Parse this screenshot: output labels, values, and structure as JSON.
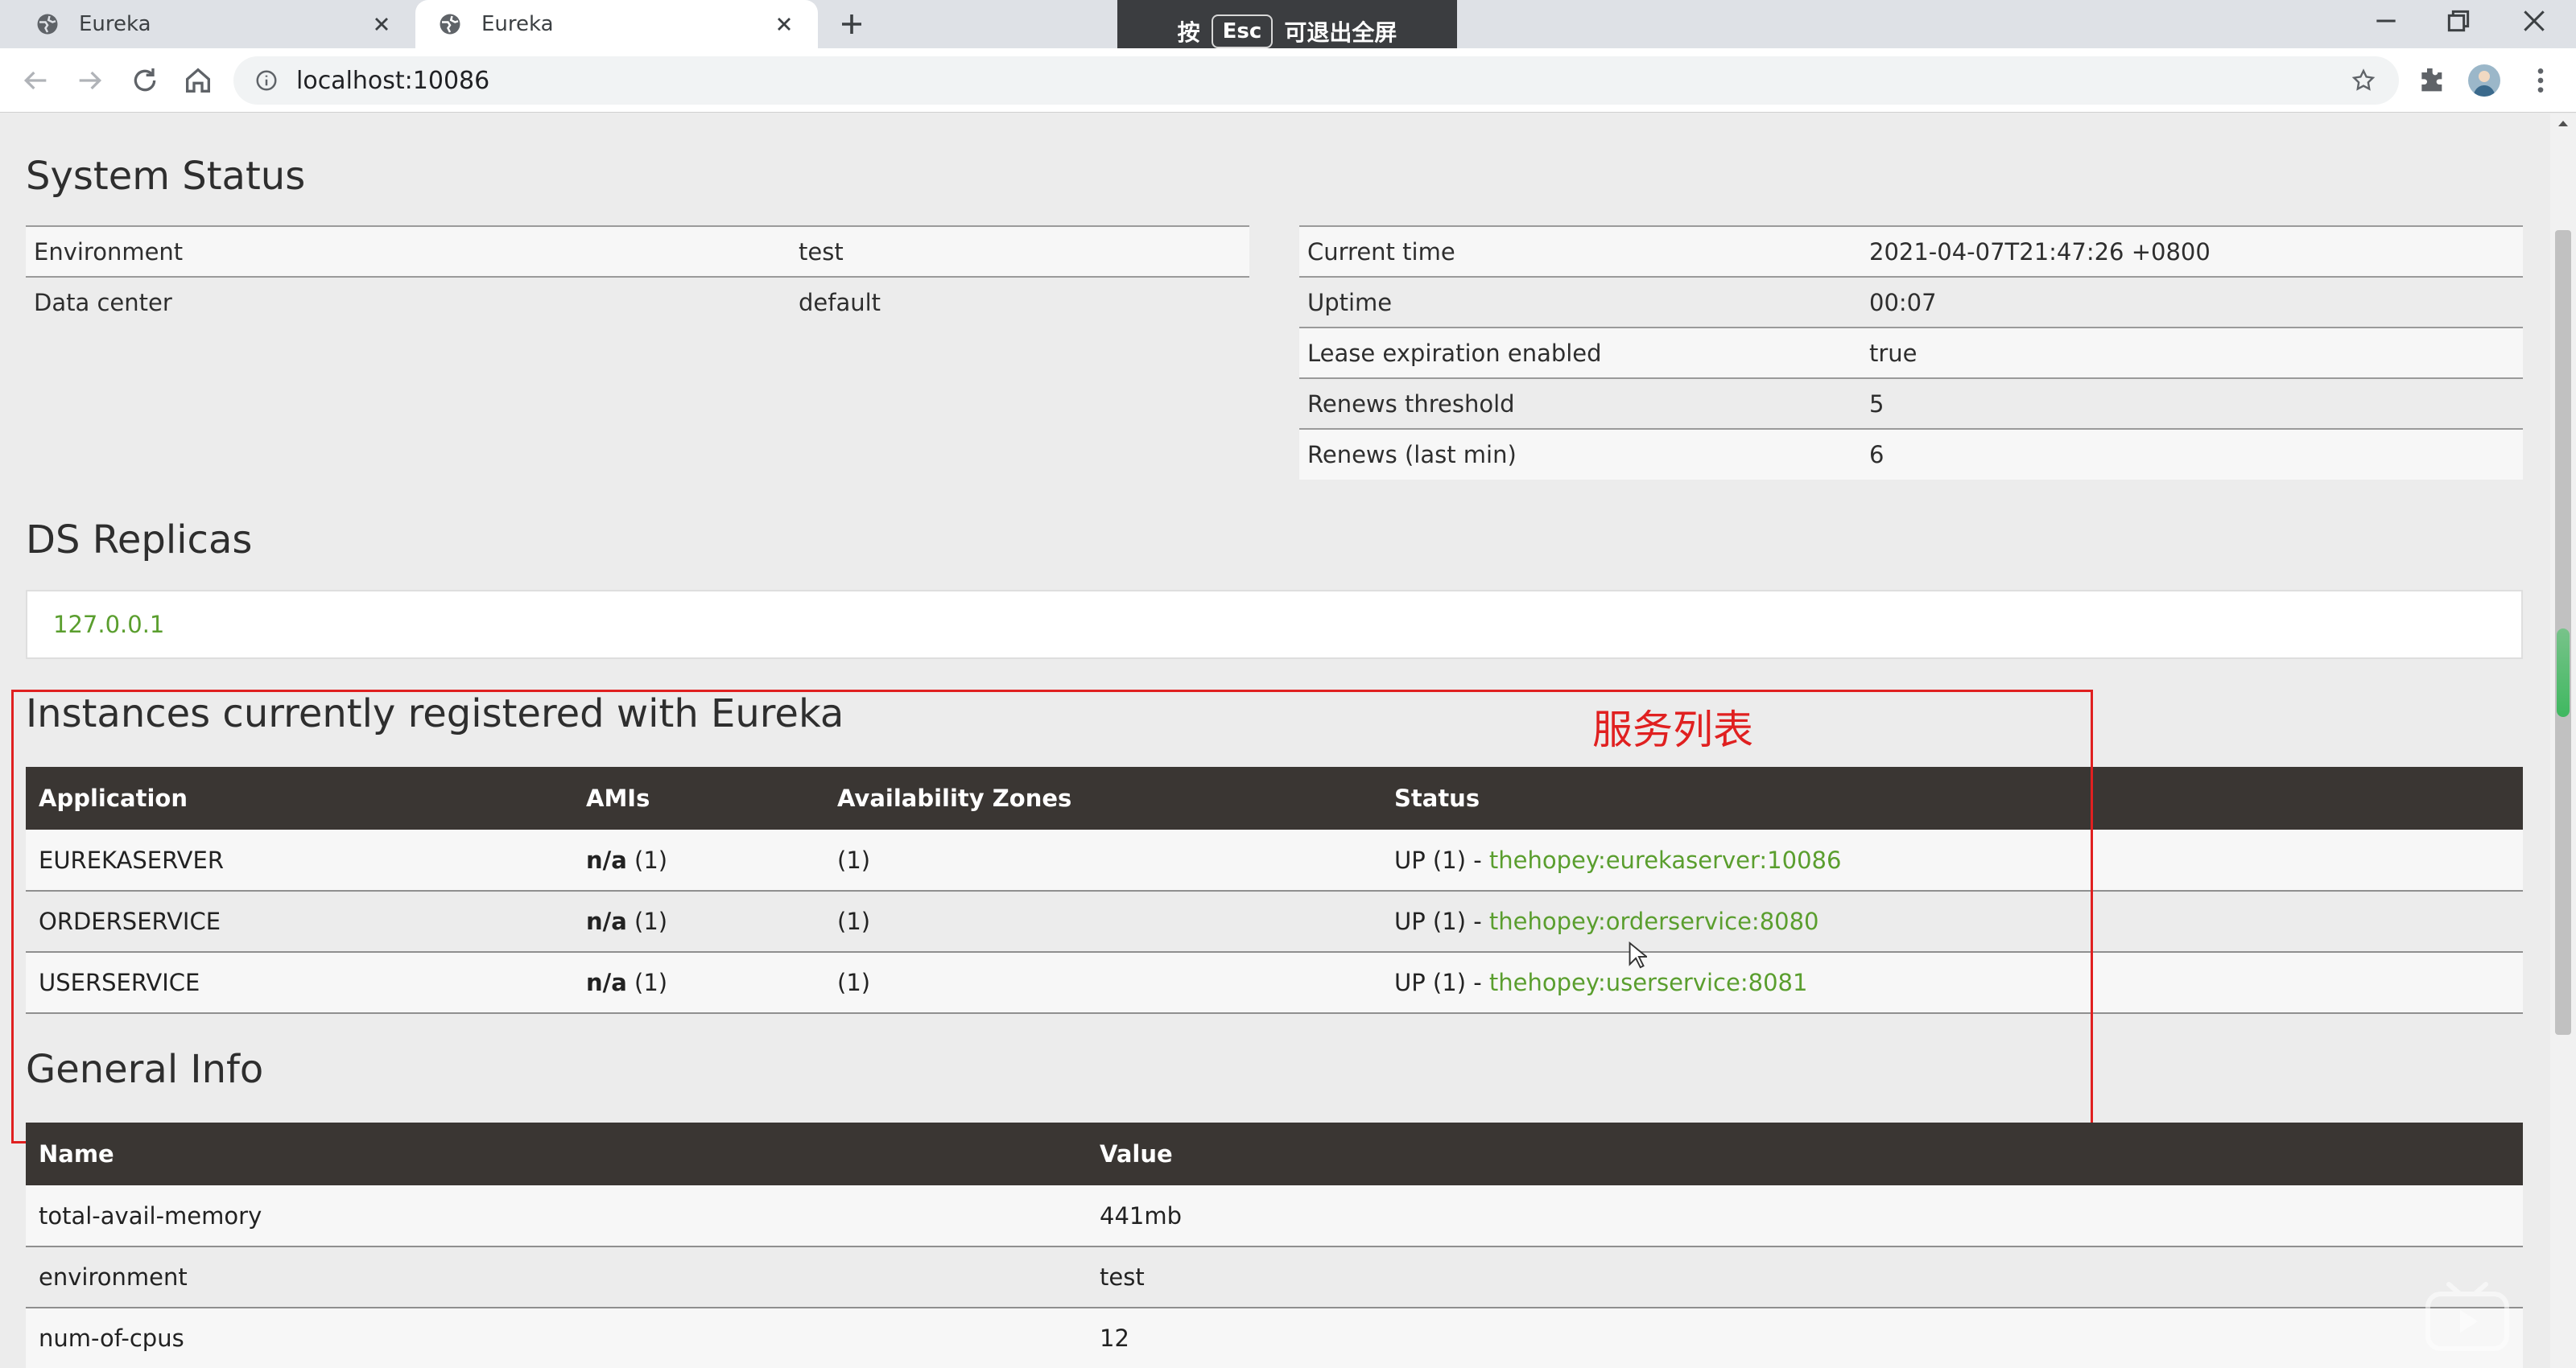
{
  "browser": {
    "tabs": [
      {
        "title": "Eureka",
        "active": false
      },
      {
        "title": "Eureka",
        "active": true
      }
    ],
    "url": "localhost:10086",
    "fullscreen_toast": {
      "prefix": "按",
      "key": "Esc",
      "suffix": "可退出全屏"
    }
  },
  "system_status": {
    "title": "System Status",
    "left": [
      {
        "label": "Environment",
        "value": "test"
      },
      {
        "label": "Data center",
        "value": "default"
      }
    ],
    "right": [
      {
        "label": "Current time",
        "value": "2021-04-07T21:47:26 +0800"
      },
      {
        "label": "Uptime",
        "value": "00:07"
      },
      {
        "label": "Lease expiration enabled",
        "value": "true"
      },
      {
        "label": "Renews threshold",
        "value": "5"
      },
      {
        "label": "Renews (last min)",
        "value": "6"
      }
    ]
  },
  "ds_replicas": {
    "title": "DS Replicas",
    "items": [
      "127.0.0.1"
    ]
  },
  "instances": {
    "title": "Instances currently registered with Eureka",
    "annotation": "服务列表",
    "columns": [
      "Application",
      "AMIs",
      "Availability Zones",
      "Status"
    ],
    "rows": [
      {
        "application": "EUREKASERVER",
        "ami_label": "n/a",
        "ami_count": "(1)",
        "zones": "(1)",
        "status": "UP (1) - ",
        "instance": "thehopey:eurekaserver:10086"
      },
      {
        "application": "ORDERSERVICE",
        "ami_label": "n/a",
        "ami_count": "(1)",
        "zones": "(1)",
        "status": "UP (1) - ",
        "instance": "thehopey:orderservice:8080"
      },
      {
        "application": "USERSERVICE",
        "ami_label": "n/a",
        "ami_count": "(1)",
        "zones": "(1)",
        "status": "UP (1) - ",
        "instance": "thehopey:userservice:8081"
      }
    ]
  },
  "general_info": {
    "title": "General Info",
    "columns": [
      "Name",
      "Value"
    ],
    "rows": [
      {
        "name": "total-avail-memory",
        "value": "441mb"
      },
      {
        "name": "environment",
        "value": "test"
      },
      {
        "name": "num-of-cpus",
        "value": "12"
      }
    ]
  },
  "colors": {
    "accent_link": "#5a9e2e",
    "table_header": "#3a3633",
    "annotation_red": "#e02020"
  }
}
